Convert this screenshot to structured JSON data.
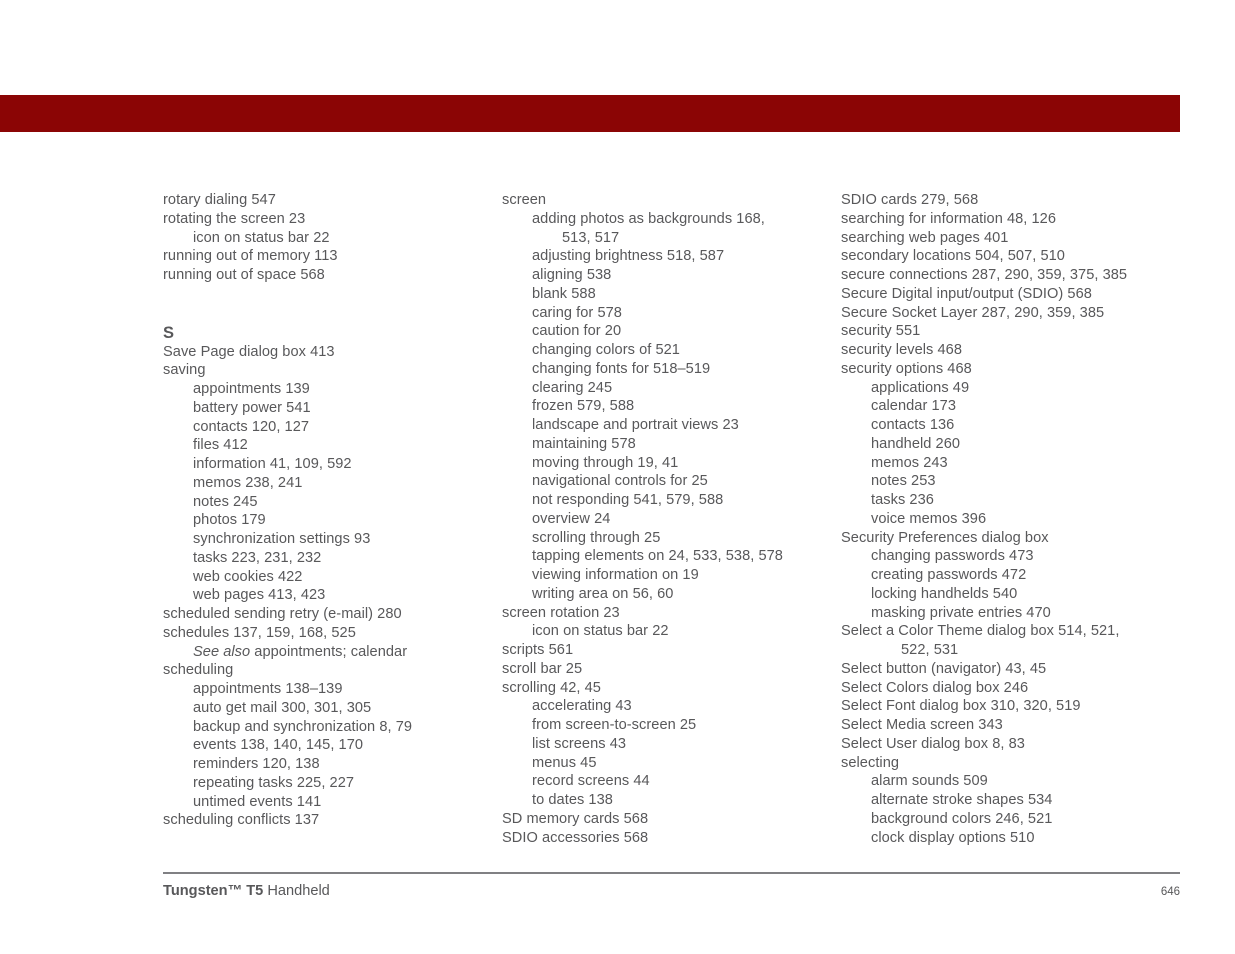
{
  "page": {
    "header_band_color": "#8b0505",
    "text_color": "#58585a",
    "rule_color": "#808083"
  },
  "footer": {
    "brand": "Tungsten™ T5",
    "product": " Handheld",
    "page_number": "646"
  },
  "columns": [
    {
      "id": "column-1",
      "entries": [
        {
          "level": 0,
          "text": "rotary dialing 547"
        },
        {
          "level": 0,
          "text": "rotating the screen 23"
        },
        {
          "level": 1,
          "text": "icon on status bar 22"
        },
        {
          "level": 0,
          "text": "running out of memory 113"
        },
        {
          "level": 0,
          "text": "running out of space 568"
        },
        {
          "type": "blank"
        },
        {
          "type": "letter",
          "text": "S"
        },
        {
          "level": 0,
          "text": "Save Page dialog box 413"
        },
        {
          "level": 0,
          "text": "saving"
        },
        {
          "level": 1,
          "text": "appointments 139"
        },
        {
          "level": 1,
          "text": "battery power 541"
        },
        {
          "level": 1,
          "text": "contacts 120, 127"
        },
        {
          "level": 1,
          "text": "files 412"
        },
        {
          "level": 1,
          "text": "information 41, 109, 592"
        },
        {
          "level": 1,
          "text": "memos 238, 241"
        },
        {
          "level": 1,
          "text": "notes 245"
        },
        {
          "level": 1,
          "text": "photos 179"
        },
        {
          "level": 1,
          "text": "synchronization settings 93"
        },
        {
          "level": 1,
          "text": "tasks 223, 231, 232"
        },
        {
          "level": 1,
          "text": "web cookies 422"
        },
        {
          "level": 1,
          "text": "web pages 413, 423"
        },
        {
          "level": 0,
          "text": "scheduled sending retry (e-mail) 280"
        },
        {
          "level": 0,
          "text": "schedules 137, 159, 168, 525"
        },
        {
          "level": 1,
          "type": "see-also",
          "italic": "See also",
          "text": " appointments; calendar"
        },
        {
          "level": 0,
          "text": "scheduling"
        },
        {
          "level": 1,
          "text": "appointments 138–139"
        },
        {
          "level": 1,
          "text": "auto get mail 300, 301, 305"
        },
        {
          "level": 1,
          "text": "backup and synchronization 8, 79"
        },
        {
          "level": 1,
          "text": "events 138, 140, 145, 170"
        },
        {
          "level": 1,
          "text": "reminders 120, 138"
        },
        {
          "level": 1,
          "text": "repeating tasks 225, 227"
        },
        {
          "level": 1,
          "text": "untimed events 141"
        },
        {
          "level": 0,
          "text": "scheduling conflicts 137"
        }
      ]
    },
    {
      "id": "column-2",
      "entries": [
        {
          "level": 0,
          "text": "screen"
        },
        {
          "level": 1,
          "text": "adding photos as backgrounds 168,"
        },
        {
          "level": 2,
          "text": "513, 517"
        },
        {
          "level": 1,
          "text": "adjusting brightness 518, 587"
        },
        {
          "level": 1,
          "text": "aligning 538"
        },
        {
          "level": 1,
          "text": "blank 588"
        },
        {
          "level": 1,
          "text": "caring for 578"
        },
        {
          "level": 1,
          "text": "caution for 20"
        },
        {
          "level": 1,
          "text": "changing colors of 521"
        },
        {
          "level": 1,
          "text": "changing fonts for 518–519"
        },
        {
          "level": 1,
          "text": "clearing 245"
        },
        {
          "level": 1,
          "text": "frozen 579, 588"
        },
        {
          "level": 1,
          "text": "landscape and portrait views 23"
        },
        {
          "level": 1,
          "text": "maintaining 578"
        },
        {
          "level": 1,
          "text": "moving through 19, 41"
        },
        {
          "level": 1,
          "text": "navigational controls for 25"
        },
        {
          "level": 1,
          "text": "not responding 541, 579, 588"
        },
        {
          "level": 1,
          "text": "overview 24"
        },
        {
          "level": 1,
          "text": "scrolling through 25"
        },
        {
          "level": 1,
          "text": "tapping elements on 24, 533, 538, 578"
        },
        {
          "level": 1,
          "text": "viewing information on 19"
        },
        {
          "level": 1,
          "text": "writing area on 56, 60"
        },
        {
          "level": 0,
          "text": "screen rotation 23"
        },
        {
          "level": 1,
          "text": "icon on status bar 22"
        },
        {
          "level": 0,
          "text": "scripts 561"
        },
        {
          "level": 0,
          "text": "scroll bar 25"
        },
        {
          "level": 0,
          "text": "scrolling 42, 45"
        },
        {
          "level": 1,
          "text": "accelerating 43"
        },
        {
          "level": 1,
          "text": "from screen-to-screen 25"
        },
        {
          "level": 1,
          "text": "list screens 43"
        },
        {
          "level": 1,
          "text": "menus 45"
        },
        {
          "level": 1,
          "text": "record screens 44"
        },
        {
          "level": 1,
          "text": "to dates 138"
        },
        {
          "level": 0,
          "text": "SD memory cards 568"
        },
        {
          "level": 0,
          "text": "SDIO accessories 568"
        }
      ]
    },
    {
      "id": "column-3",
      "entries": [
        {
          "level": 0,
          "text": "SDIO cards 279, 568"
        },
        {
          "level": 0,
          "text": "searching for information 48, 126"
        },
        {
          "level": 0,
          "text": "searching web pages 401"
        },
        {
          "level": 0,
          "text": "secondary locations 504, 507, 510"
        },
        {
          "level": 0,
          "text": "secure connections 287, 290, 359, 375, 385"
        },
        {
          "level": 0,
          "text": "Secure Digital input/output (SDIO) 568"
        },
        {
          "level": 0,
          "text": "Secure Socket Layer 287, 290, 359, 385"
        },
        {
          "level": 0,
          "text": "security 551"
        },
        {
          "level": 0,
          "text": "security levels 468"
        },
        {
          "level": 0,
          "text": "security options 468"
        },
        {
          "level": 1,
          "text": "applications 49"
        },
        {
          "level": 1,
          "text": "calendar 173"
        },
        {
          "level": 1,
          "text": "contacts 136"
        },
        {
          "level": 1,
          "text": "handheld 260"
        },
        {
          "level": 1,
          "text": "memos 243"
        },
        {
          "level": 1,
          "text": "notes 253"
        },
        {
          "level": 1,
          "text": "tasks 236"
        },
        {
          "level": 1,
          "text": "voice memos 396"
        },
        {
          "level": 0,
          "text": "Security Preferences dialog box"
        },
        {
          "level": 1,
          "text": "changing passwords 473"
        },
        {
          "level": 1,
          "text": "creating passwords 472"
        },
        {
          "level": 1,
          "text": "locking handhelds 540"
        },
        {
          "level": 1,
          "text": "masking private entries 470"
        },
        {
          "level": 0,
          "text": "Select a Color Theme dialog box 514, 521,"
        },
        {
          "level": 2,
          "text": "522, 531"
        },
        {
          "level": 0,
          "text": "Select button (navigator) 43, 45"
        },
        {
          "level": 0,
          "text": "Select Colors dialog box 246"
        },
        {
          "level": 0,
          "text": "Select Font dialog box 310, 320, 519"
        },
        {
          "level": 0,
          "text": "Select Media screen 343"
        },
        {
          "level": 0,
          "text": "Select User dialog box 8, 83"
        },
        {
          "level": 0,
          "text": "selecting"
        },
        {
          "level": 1,
          "text": "alarm sounds 509"
        },
        {
          "level": 1,
          "text": "alternate stroke shapes 534"
        },
        {
          "level": 1,
          "text": "background colors 246, 521"
        },
        {
          "level": 1,
          "text": "clock display options 510"
        }
      ]
    }
  ]
}
